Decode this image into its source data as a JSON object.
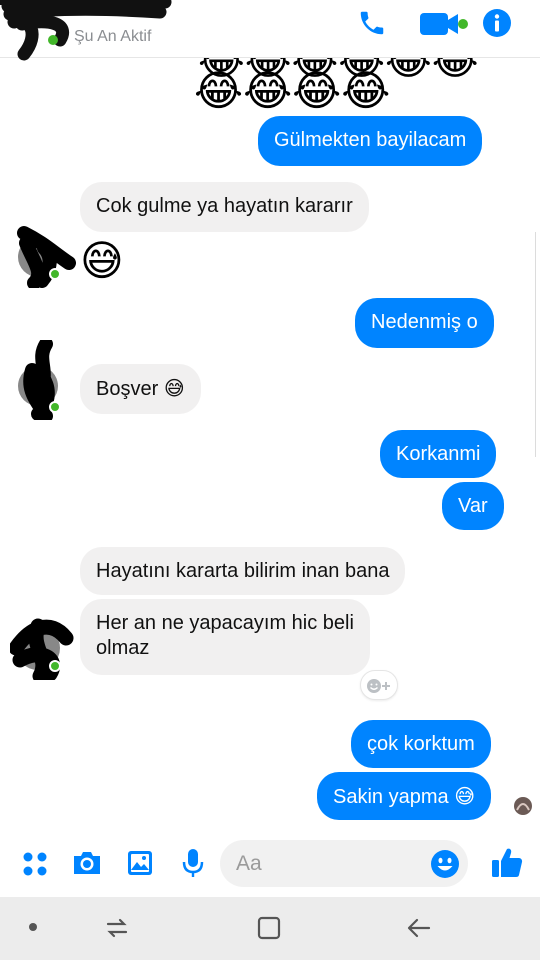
{
  "header": {
    "status": "Şu An Aktif",
    "icons": [
      "phone-icon",
      "video-icon",
      "info-icon"
    ]
  },
  "messages": [
    {
      "dir": "out",
      "text": "Gülmekten bayilacam"
    },
    {
      "dir": "in",
      "text": "Cok gulme ya hayatın kararır"
    },
    {
      "dir": "out",
      "text": "Nedenmiş o"
    },
    {
      "dir": "in",
      "text": "Boşver"
    },
    {
      "dir": "out",
      "text": "Korkanmi"
    },
    {
      "dir": "out",
      "text": "Var"
    },
    {
      "dir": "in",
      "text": "Hayatını kararta bilirim inan bana"
    },
    {
      "dir": "in",
      "text_line1": "Her an ne yapacayım hic beli",
      "text_line2": "olmaz"
    },
    {
      "dir": "out",
      "text": "çok korktum"
    },
    {
      "dir": "out",
      "text": "Sakin yapma"
    }
  ],
  "composer": {
    "placeholder": "Aa",
    "icons": [
      "apps-icon",
      "camera-icon",
      "image-icon",
      "microphone-icon",
      "emoji-icon",
      "thumbs-up-icon"
    ]
  },
  "colors": {
    "accent": "#0084ff",
    "incoming_bubble": "#f1f0f0",
    "online": "#42b72a"
  }
}
